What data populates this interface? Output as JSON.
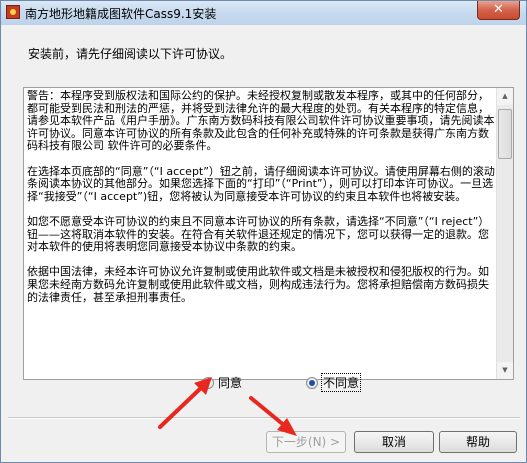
{
  "window": {
    "title": "南方地形地籍成图软件Cass9.1安装",
    "close_label": "✕"
  },
  "prompt": "安装前，请先仔细阅读以下许可协议。",
  "license": {
    "paragraphs": [
      "警告：本程序受到版权法和国际公约的保护。未经授权复制或散发本程序，或其中的任何部分，都可能受到民法和刑法的严惩，并将受到法律允许的最大程度的处罚。有关本程序的特定信息，请参见本软件产品《用户手册》。广东南方数码科技有限公司软件许可协议重要事项，请先阅读本许可协议。同意本许可协议的所有条款及此包含的任何补充或特殊的许可条款是获得广东南方数码科技有限公司 软件许可的必要条件。",
      "在选择本页底部的“同意”（“I accept”）钮之前，请仔细阅读本许可协议。请使用屏幕右侧的滚动条阅读本协议的其他部分。如果您选择下面的“打印”（“Print”），则可以打印本许可协议。一旦选择“我接受”（“I accept”)钮，您将被认为同意接受本许可协议的约束且本软件也将被安装。",
      "如您不愿意受本许可协议的约束且不同意本许可协议的所有条款，请选择“不同意”（“I reject”）钮——这将取消本软件的安装。在符合有关软件退还规定的情况下，您可以获得一定的退款。您对本软件的使用将表明您同意接受本协议中条款的约束。",
      "依据中国法律，未经本许可协议允许复制或使用此软件或文档是未被授权和侵犯版权的行为。如果您未经南方数码允许复制或使用此软件或文档，则构成违法行为。您将承担赔偿南方数码损失的法律责任，甚至承担刑事责任。"
    ]
  },
  "options": {
    "agree_label": "同意",
    "disagree_label": "不同意",
    "selected": "disagree"
  },
  "buttons": {
    "next_label": "下一步(N) >",
    "cancel_label": "取消",
    "help_label": "帮助"
  },
  "colors": {
    "annotation_arrow": "#e8281e"
  }
}
